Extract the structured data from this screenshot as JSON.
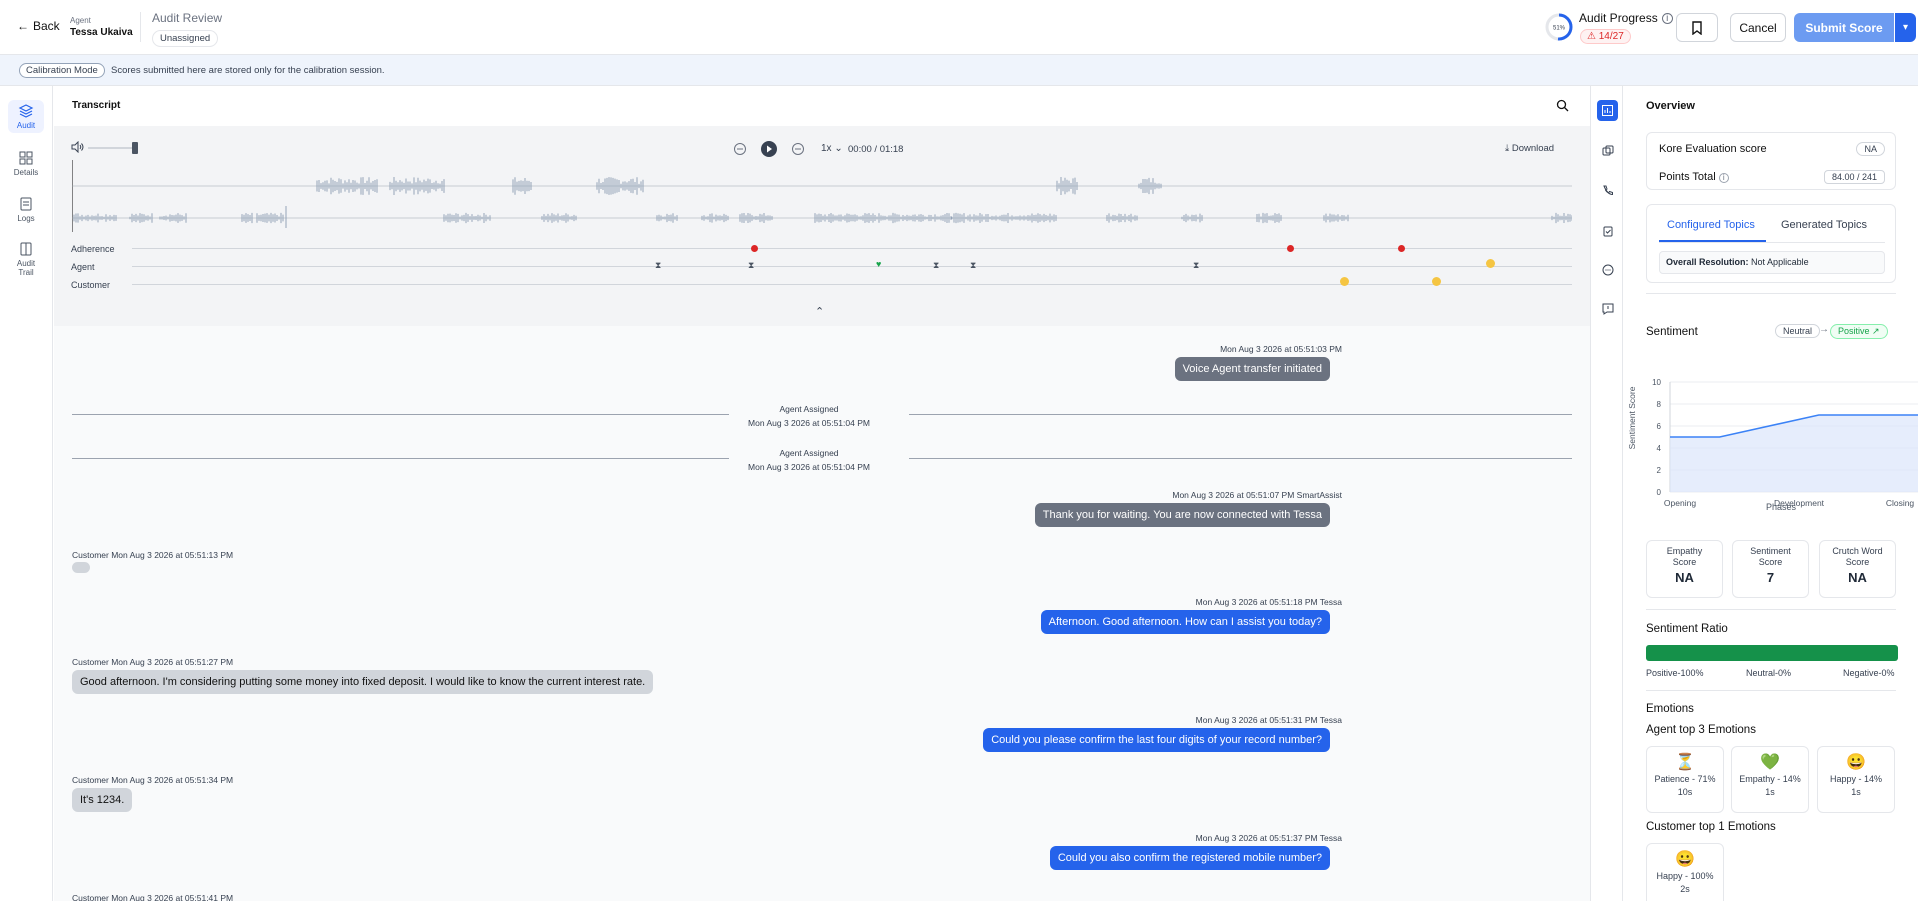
{
  "header": {
    "back_label": "Back",
    "agent_label": "Agent",
    "agent_name": "Tessa Ukaiva",
    "page_title": "Audit Review",
    "assignment_status": "Unassigned",
    "progress_percent": "51%",
    "progress_title": "Audit Progress",
    "progress_warning": "14/27",
    "cancel_label": "Cancel",
    "submit_label": "Submit Score"
  },
  "calibration": {
    "mode_label": "Calibration Mode",
    "message": "Scores submitted here are stored only for the calibration session."
  },
  "leftnav": [
    {
      "label": "Audit",
      "icon": "layers-icon"
    },
    {
      "label": "Details",
      "icon": "grid-icon"
    },
    {
      "label": "Logs",
      "icon": "document-icon"
    },
    {
      "label": "Audit Trail",
      "icon": "book-icon"
    }
  ],
  "transcript": {
    "title": "Transcript",
    "speed": "1x",
    "time": "00:00 / 01:18",
    "download_label": "Download",
    "tracks": [
      "Adherence",
      "Agent",
      "Customer"
    ]
  },
  "messages": [
    {
      "meta": "Mon Aug 3 2026 at 05:51:03 PM",
      "text": "Voice Agent transfer initiated"
    },
    {
      "divider_title": "Agent Assigned",
      "divider_time": "Mon Aug 3 2026 at 05:51:04 PM"
    },
    {
      "divider_title": "Agent Assigned",
      "divider_time": "Mon Aug 3 2026 at 05:51:04 PM"
    },
    {
      "meta": "Mon Aug 3 2026 at 05:51:07 PM SmartAssist",
      "text": "Thank you for waiting. You are now connected with Tessa"
    },
    {
      "meta": "Customer Mon Aug 3 2026 at 05:51:13 PM",
      "text": ""
    },
    {
      "meta": "Mon Aug 3 2026 at 05:51:18 PM Tessa",
      "text": "Afternoon. Good afternoon. How can I assist you today?"
    },
    {
      "meta": "Customer Mon Aug 3 2026 at 05:51:27 PM",
      "text": "Good afternoon. I'm considering putting some money into fixed deposit. I would like to know the current interest rate."
    },
    {
      "meta": "Mon Aug 3 2026 at 05:51:31 PM Tessa",
      "text": "Could you please confirm the last four digits of your record number?"
    },
    {
      "meta": "Customer Mon Aug 3 2026 at 05:51:34 PM",
      "text": "It's 1234."
    },
    {
      "meta": "Mon Aug 3 2026 at 05:51:37 PM Tessa",
      "text": "Could you also confirm the registered mobile number?"
    },
    {
      "meta": "Customer Mon Aug 3 2026 at 05:51:41 PM",
      "text": ""
    }
  ],
  "overview": {
    "title": "Overview",
    "kore_label": "Kore Evaluation score",
    "kore_value": "NA",
    "points_label": "Points Total",
    "points_value": "84.00 / 241",
    "tab_configured": "Configured Topics",
    "tab_generated": "Generated Topics",
    "resolution_label": "Overall Resolution:",
    "resolution_value": "Not Applicable"
  },
  "sentiment": {
    "title": "Sentiment",
    "from": "Neutral",
    "to": "Positive ↗",
    "ylabel": "Sentiment Score",
    "xlabel": "Phases"
  },
  "chart_data": {
    "type": "area",
    "categories": [
      "Opening",
      "Development",
      "Closing"
    ],
    "x": [
      0,
      0.2,
      0.6,
      1.0
    ],
    "values": [
      5,
      5,
      7,
      7
    ],
    "xlabel": "Phases",
    "ylabel": "Sentiment Score",
    "ylim": [
      0,
      10
    ],
    "yticks": [
      0,
      2,
      4,
      6,
      8,
      10
    ]
  },
  "scores": [
    {
      "label": "Empathy Score",
      "value": "NA"
    },
    {
      "label": "Sentiment Score",
      "value": "7"
    },
    {
      "label": "Crutch Word Score",
      "value": "NA"
    }
  ],
  "ratio": {
    "title": "Sentiment Ratio",
    "positive_fraction": 1.0,
    "positive": "Positive-100%",
    "neutral": "Neutral-0%",
    "negative": "Negative-0%"
  },
  "emotions": {
    "title": "Emotions",
    "agent_title": "Agent top 3 Emotions",
    "agent": [
      {
        "icon": "hourglass-icon",
        "glyph": "⏳",
        "label": "Patience - 71%",
        "dur": "10s"
      },
      {
        "icon": "green-heart-icon",
        "glyph": "💚",
        "label": "Empathy - 14%",
        "dur": "1s"
      },
      {
        "icon": "smile-icon",
        "glyph": "😀",
        "label": "Happy - 14%",
        "dur": "1s"
      }
    ],
    "customer_title": "Customer top 1 Emotions",
    "customer": [
      {
        "icon": "smile-icon",
        "glyph": "😀",
        "label": "Happy - 100%",
        "dur": "2s"
      }
    ]
  }
}
